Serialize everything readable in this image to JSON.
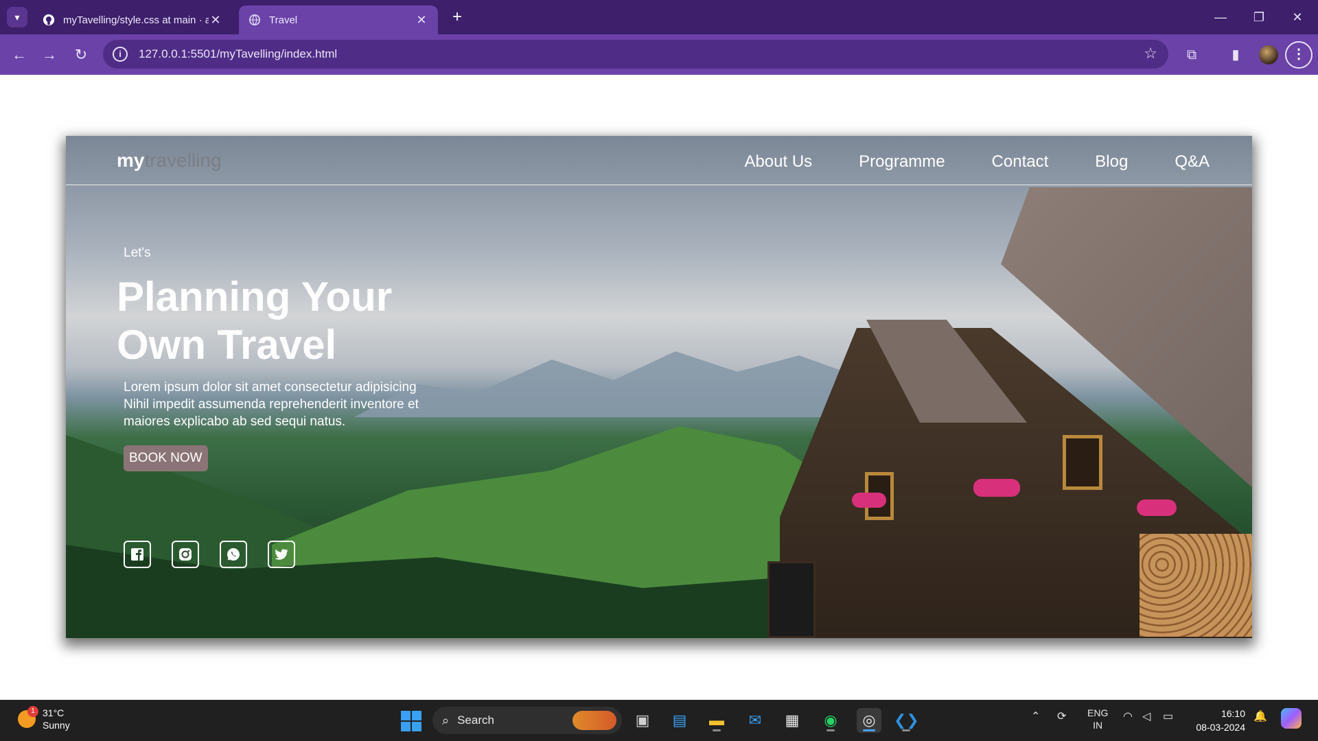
{
  "browser": {
    "tabs": [
      {
        "title": "myTavelling/style.css at main · a",
        "active": false
      },
      {
        "title": "Travel",
        "active": true
      }
    ],
    "url": "127.0.0.1:5501/myTavelling/index.html",
    "new_tab_symbol": "+",
    "tab_close_symbol": "✕"
  },
  "site": {
    "logo_bold": "my",
    "logo_rest": "travelling",
    "nav": [
      "About Us",
      "Programme",
      "Contact",
      "Blog",
      "Q&A"
    ],
    "hero": {
      "kicker": "Let's",
      "headline_line1": "Planning Your",
      "headline_line2": "Own Travel",
      "lead": "Lorem ipsum dolor sit amet consectetur adipisicing Nihil impedit assumenda reprehenderit inventore et maiores explicabo ab sed sequi natus.",
      "cta": "BOOK NOW"
    },
    "socials": [
      "facebook-icon",
      "instagram-icon",
      "whatsapp-icon",
      "twitter-icon"
    ]
  },
  "taskbar": {
    "weather_temp": "31°C",
    "weather_desc": "Sunny",
    "weather_badge": "1",
    "search_label": "Search",
    "lang_top": "ENG",
    "lang_bottom": "IN",
    "time": "16:10",
    "date": "08-03-2024"
  },
  "colors": {
    "tabbar": "#3d1f6b",
    "toolbar": "#6a42a8",
    "button": "#8b7476",
    "taskbar": "#202020"
  }
}
